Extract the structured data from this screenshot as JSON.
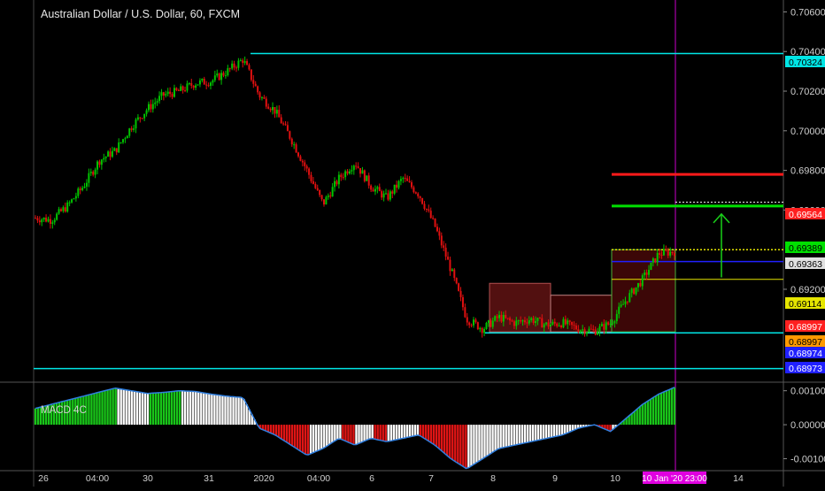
{
  "chart_data": [
    {
      "type": "candlestick",
      "title": "Australian Dollar / U.S. Dollar, 60, FXCM",
      "x_ticks": [
        "26",
        "04:00",
        "30",
        "31",
        "2020",
        "04:00",
        "6",
        "7",
        "8",
        "9",
        "10",
        "14"
      ],
      "cursor_label": "10 Jan '20   23:00",
      "y_ticks": [
        "0.70600",
        "0.70400",
        "0.70200",
        "0.70000",
        "0.69800",
        "0.69600",
        "0.69200"
      ],
      "ylim": [
        0.6874,
        0.7066
      ],
      "price_labels": [
        {
          "text": "0.70324",
          "value": 0.70324,
          "color": "#00e5e5"
        },
        {
          "text": "0.69564",
          "value": 0.69564,
          "color": "#ff2020"
        },
        {
          "text": "0.69389",
          "value": 0.69389,
          "color": "#00e000"
        },
        {
          "text": "0.69363",
          "value": 0.69363,
          "color": "#e0e0e0"
        },
        {
          "text": "0.69114",
          "value": 0.69114,
          "color": "#e5e500"
        },
        {
          "text": "0.68997",
          "value": 0.68997,
          "color": "#ff2020"
        },
        {
          "text": "0.68997",
          "value": 0.68997,
          "color": "#ff9900"
        },
        {
          "text": "0.68974",
          "value": 0.68974,
          "color": "#2020ff"
        },
        {
          "text": "0.68973",
          "value": 0.68973,
          "color": "#2020ff"
        }
      ],
      "ohlc_path": [
        0.6956,
        0.6955,
        0.6962,
        0.6972,
        0.6985,
        0.699,
        0.7002,
        0.7011,
        0.7018,
        0.702,
        0.7024,
        0.7025,
        0.703,
        0.7036,
        0.7018,
        0.701,
        0.6996,
        0.698,
        0.6963,
        0.6976,
        0.6984,
        0.6972,
        0.6966,
        0.6976,
        0.6968,
        0.6952,
        0.693,
        0.6905,
        0.69,
        0.6906,
        0.6903,
        0.6905,
        0.6902,
        0.6903,
        0.69,
        0.6899,
        0.6903,
        0.6915,
        0.6925,
        0.6938,
        0.6939
      ],
      "levels": [
        {
          "value": 0.7039,
          "color": "#00e5e5"
        },
        {
          "value": 0.6898,
          "color": "#00e5e5"
        },
        {
          "value": 0.688,
          "color": "#00e5e5"
        },
        {
          "value": 0.6978,
          "color": "#ff1a1a"
        },
        {
          "value": 0.6962,
          "color": "#00e000"
        },
        {
          "value": 0.6964,
          "color": "#f0f0f0"
        },
        {
          "value": 0.694,
          "color": "#e5e500"
        },
        {
          "value": 0.6934,
          "color": "#2020ff"
        },
        {
          "value": 0.6925,
          "color": "#e5e500"
        }
      ]
    },
    {
      "type": "bar",
      "title": "MACD 4C",
      "y_ticks": [
        "0.00100",
        "0.00000",
        "-0.00100"
      ],
      "ylim": [
        -0.0013,
        0.0012
      ],
      "values": [
        0.00048,
        0.0006,
        0.00072,
        0.00084,
        0.00096,
        0.00108,
        0.001,
        0.00092,
        0.00095,
        0.001,
        0.00098,
        0.0009,
        0.00084,
        0.0008,
        -0.0001,
        -0.0003,
        -0.0006,
        -0.0009,
        -0.0007,
        -0.0004,
        -0.0006,
        -0.0004,
        -0.0005,
        -0.0004,
        -0.0003,
        -0.0006,
        -0.001,
        -0.0013,
        -0.001,
        -0.0007,
        -0.0006,
        -0.0005,
        -0.0004,
        -0.0003,
        -0.0001,
        0.0,
        -0.0002,
        0.0002,
        0.0006,
        0.0009,
        0.0011
      ]
    }
  ],
  "colors": {
    "background": "#000000",
    "bull": "#00c400",
    "bear": "#e01010",
    "macd_green": "#19c519",
    "macd_red": "#e01515",
    "macd_white": "#ffffff",
    "macd_line": "#2f7fe0",
    "cursor_line": "#cc00cc",
    "cursor_label_bg": "#e000e0"
  }
}
